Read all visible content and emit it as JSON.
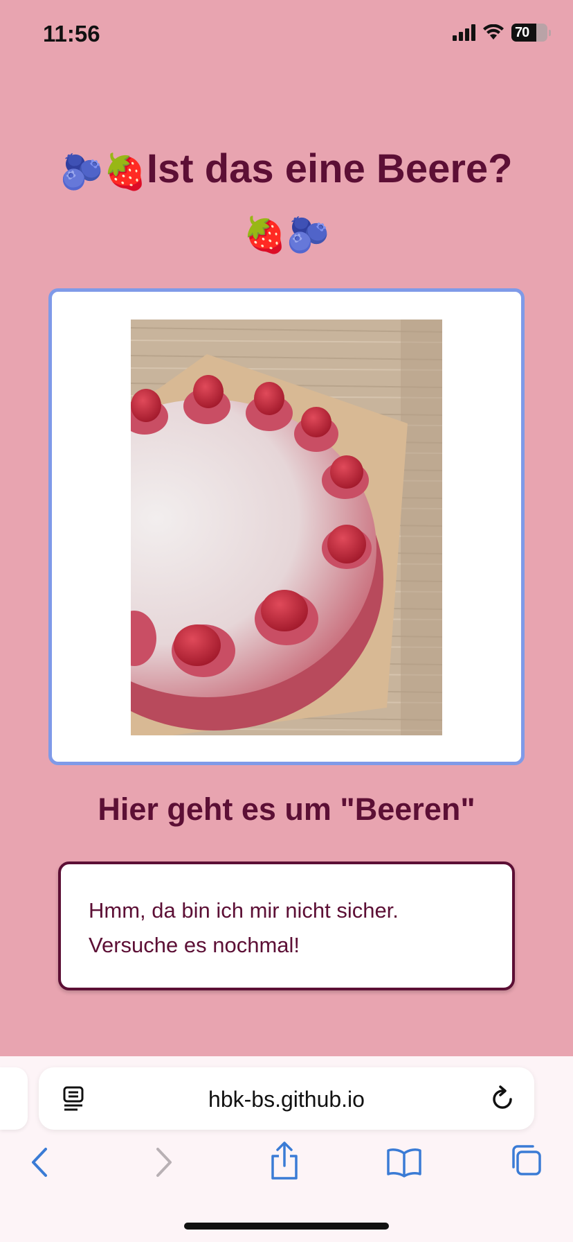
{
  "status_bar": {
    "time": "11:56",
    "battery": "70"
  },
  "page": {
    "title_emoji_left": "🫐🍓",
    "title_text": "Ist das eine Beere?",
    "title_emoji_right": "🍓🫐",
    "image_alt": "Himbeertorte",
    "subtitle": "Hier geht es um \"Beeren\"",
    "feedback_line1": "Hmm, da bin ich mir nicht sicher.",
    "feedback_line2": "Versuche es nochmal!"
  },
  "browser": {
    "url": "hbk-bs.github.io"
  },
  "colors": {
    "background": "#e8a4b0",
    "heading": "#5c0f35",
    "card_border": "#7f9ae8",
    "accent_blue": "#3a7bd5"
  },
  "icons": [
    "wifi-icon",
    "cellular-signal-icon",
    "battery-icon",
    "reader-mode-icon",
    "reload-icon",
    "back-icon",
    "forward-icon",
    "share-icon",
    "bookmarks-icon",
    "tabs-icon"
  ]
}
